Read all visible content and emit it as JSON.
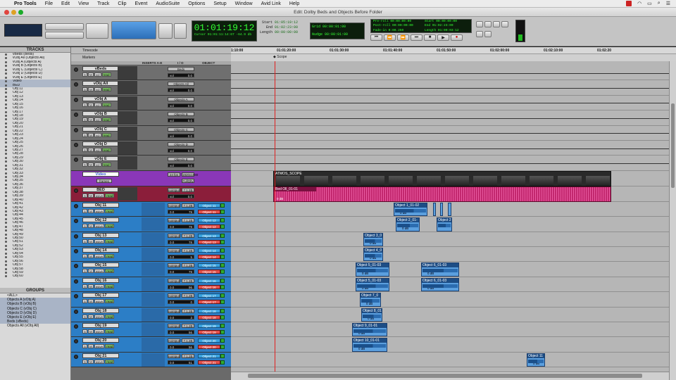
{
  "menubar": {
    "app": "Pro Tools",
    "items": [
      "File",
      "Edit",
      "View",
      "Track",
      "Clip",
      "Event",
      "AudioSuite",
      "Options",
      "Setup",
      "Window",
      "Avid Link",
      "Help"
    ]
  },
  "window": {
    "title": "Edit: Dolby Beds and Objects Before Folder"
  },
  "counter": {
    "main": "01:01:19:12",
    "cursor_label": "Cursor",
    "cursor": "01:01:11:14:67",
    "level": "-64.9 db"
  },
  "selection": {
    "start_label": "Start",
    "end_label": "End",
    "length_label": "Length",
    "start": "01:05:19:12",
    "end": "01:02:23:00",
    "length": "00:00:00:00"
  },
  "grid": {
    "grid_label": "Grid",
    "grid": "00:00:01:00",
    "nudge_label": "Nudge",
    "nudge": "00:00:01:00"
  },
  "preroll": {
    "pre_label": "Pre-roll",
    "post_label": "Post-roll",
    "fade_label": "Fade-in",
    "pre": "00:00:00:00",
    "post": "00:00:00:00",
    "fade": "0:00.250"
  },
  "transport_sel": {
    "start_label": "Start",
    "end_label": "End",
    "length_label": "Length",
    "start": "00:00:00:00",
    "end": "01:02:23:00",
    "length": "01:00:03:12"
  },
  "ruler": {
    "timecode_label": "Timecode",
    "markers_label": "Markers",
    "marker_name": "Scope",
    "ticks": [
      "1:10:00",
      "01:01:20:00",
      "01:01:30:00",
      "01:01:40:00",
      "01:01:50:00",
      "01:02:00:00",
      "01:02:10:00",
      "01:02:20"
    ]
  },
  "tracks_panel": {
    "title": "TRACKS",
    "rows": [
      "vBeds (Beds)",
      "vObj All (Objects All)",
      "vObj A (Objects A)",
      "vObj B (Objects B)",
      "vObj C (Objects C)",
      "vObj D (Objects D)",
      "vObj E (Objects E)",
      "Video",
      "BED",
      "Obj 11",
      "Obj 12",
      "Obj 13",
      "Obj 14",
      "Obj 15",
      "Obj 16",
      "Obj 17",
      "Obj 18",
      "Obj 19",
      "Obj 20",
      "Obj 21",
      "Obj 22",
      "Obj 23",
      "Obj 24",
      "Obj 25",
      "Obj 26",
      "Obj 27",
      "Obj 28",
      "Obj 29",
      "Obj 30",
      "Obj 31",
      "Obj 32",
      "Obj 33",
      "Obj 34",
      "Obj 35",
      "Obj 36",
      "Obj 37",
      "Obj 38",
      "Obj 39",
      "Obj 40",
      "Obj 41",
      "Obj 42",
      "Obj 43",
      "Obj 44",
      "Obj 45",
      "Obj 46",
      "Obj 47",
      "Obj 48",
      "Obj 49",
      "Obj 50",
      "Obj 51",
      "Obj 52",
      "Obj 53",
      "Obj 54",
      "Obj 55",
      "Obj 56",
      "Obj 57",
      "Obj 58",
      "Obj 59",
      "Obj 60"
    ]
  },
  "groups_panel": {
    "title": "GROUPS",
    "rows": [
      "<ALL>",
      "Objects A (vObj A)",
      "Objects B (vObj B)",
      "Objects C (vObj C)",
      "Objects D (vObj D)",
      "Objects E (vObj E)",
      "Beds (vBeds)",
      "Objects All (vObj All)"
    ]
  },
  "column_headers": {
    "inserts": "INSERTS A-E",
    "io": "I / O",
    "object": "OBJECT"
  },
  "vca_tracks": [
    {
      "name": "vBeds",
      "io": "Beds",
      "vol": "0.0"
    },
    {
      "name": "vObj All",
      "io": "Objects All",
      "vol": "0.0"
    },
    {
      "name": "vObj A",
      "io": "Objects A",
      "vol": "0.0"
    },
    {
      "name": "vObj B",
      "io": "Objects B",
      "vol": "0.0"
    },
    {
      "name": "vObj C",
      "io": "Objects C",
      "vol": "0.0"
    },
    {
      "name": "vObj D",
      "io": "Objects D",
      "vol": "0.0"
    },
    {
      "name": "vObj E",
      "io": "Objects E",
      "vol": "0.0"
    }
  ],
  "video_track": {
    "name": "Video",
    "rate": "24 fps",
    "io": "1920x1080",
    "frames": "frames",
    "quality": "FullQlty",
    "clip": "ATMOS_SCOPE"
  },
  "bed_track": {
    "name": "BED",
    "input": "nointput",
    "bus": "7.1.2B",
    "vol": "0.0",
    "clip": "Bed Oll_01-01",
    "clip_gain": "0 dB"
  },
  "obj_tracks": [
    {
      "name": "Obj 11",
      "vol": "0.0",
      "pan": "79",
      "obj": "Object 11"
    },
    {
      "name": "Obj 12",
      "vol": "0.0",
      "pan": "79",
      "obj": "Object 12"
    },
    {
      "name": "Obj 13",
      "vol": "0.0",
      "pan": "78",
      "obj": "Object 13"
    },
    {
      "name": "Obj 14",
      "vol": "0.0",
      "pan": "5",
      "obj": "Object 14"
    },
    {
      "name": "Obj 15",
      "vol": "0.0",
      "pan": "79",
      "obj": "Object 15"
    },
    {
      "name": "Obj 16",
      "vol": "0.0",
      "pan": "96",
      "obj": "Object 16"
    },
    {
      "name": "Obj 17",
      "vol": "0.0",
      "pan": "0",
      "obj": "Object 17"
    },
    {
      "name": "Obj 18",
      "vol": "0.0",
      "pan": "3",
      "obj": "Object 18"
    },
    {
      "name": "Obj 19",
      "vol": "0.0",
      "pan": "56",
      "obj": "Object 19"
    },
    {
      "name": "Obj 20",
      "vol": "0.0",
      "pan": "56",
      "obj": "Object 20"
    },
    {
      "name": "Obj 21",
      "vol": "0.0",
      "pan": "51",
      "obj": "Object 21"
    }
  ],
  "track_labels": {
    "solo": "S",
    "mute": "M",
    "vol": "vol",
    "wave": "wave",
    "read": "read",
    "input": "nointput",
    "bus": "7.1.2B"
  },
  "clips": [
    {
      "name": "Object 1_01-02",
      "gain": "0 dB"
    },
    {
      "name": "Object 2_01-",
      "gain": "0 dB"
    },
    {
      "name": "Object 2",
      "gain": ""
    },
    {
      "name": "Object 3_0",
      "gain": "0 dB"
    },
    {
      "name": "Object 4_0",
      "gain": "0 dB"
    },
    {
      "name": "Object 5_01-03",
      "gain": "0 dB"
    },
    {
      "name": "Object 5_01-03",
      "gain": "0 dB"
    },
    {
      "name": "Object 6_01-03",
      "gain": "0 dB"
    },
    {
      "name": "Object 6_01-03",
      "gain": "0 dB"
    },
    {
      "name": "Object 7_0",
      "gain": "0 dB"
    },
    {
      "name": "Object 8_01",
      "gain": "0 dB"
    },
    {
      "name": "Object 9_01-01",
      "gain": "0 dB"
    },
    {
      "name": "Object 10_01-01",
      "gain": "0 dB"
    },
    {
      "name": "Object 11",
      "gain": "0 dB"
    }
  ],
  "colors": {
    "grey_track": "#6f6f6f",
    "blue_track": "#2c7ec6",
    "video_track": "#8a37b8",
    "bed_track": "#8b1e3a",
    "clip_blue": "#5b9fde",
    "bed_clip": "#c2276e",
    "counter_green": "#33ff33"
  }
}
